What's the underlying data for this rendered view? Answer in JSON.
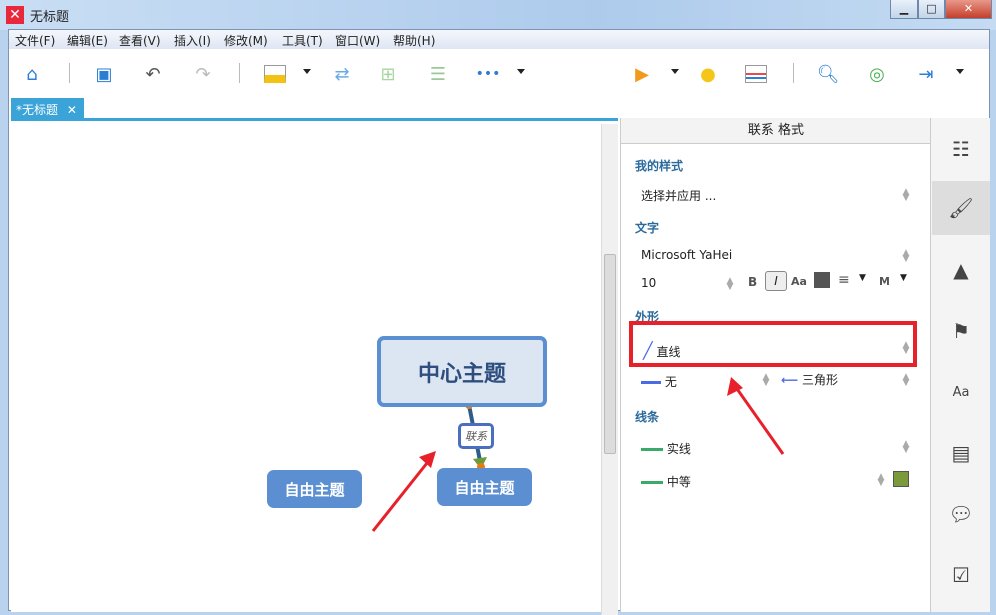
{
  "window": {
    "title": "无标题",
    "minimize": "▁",
    "maximize": "□",
    "close": "✕"
  },
  "menu": [
    "文件(F)",
    "编辑(E)",
    "查看(V)",
    "插入(I)",
    "修改(M)",
    "工具(T)",
    "窗口(W)",
    "帮助(H)"
  ],
  "toolbar": {
    "more": "•••"
  },
  "tab": {
    "label": "*无标题",
    "close": "✕"
  },
  "canvas": {
    "central_topic": "中心主题",
    "floating_topic_1": "自由主题",
    "floating_topic_2": "自由主题",
    "relationship_label": "联系"
  },
  "panel": {
    "header": "联系 格式",
    "my_style": {
      "title": "我的样式",
      "value": "选择并应用 ..."
    },
    "text": {
      "title": "文字",
      "font": "Microsoft YaHei",
      "size": "10",
      "bold": "B",
      "italic": "I",
      "case": "Aa",
      "align": "≡",
      "weight": "M",
      "color": "#555555"
    },
    "shape": {
      "title": "外形",
      "line_shape": "直线",
      "start_arrow": "无",
      "end_arrow": "三角形"
    },
    "line": {
      "title": "线条",
      "pattern": "实线",
      "width": "中等",
      "color": "#7a9a3c"
    }
  },
  "colors": {
    "accent": "#3aa3d8",
    "highlight": "#e8202a"
  }
}
